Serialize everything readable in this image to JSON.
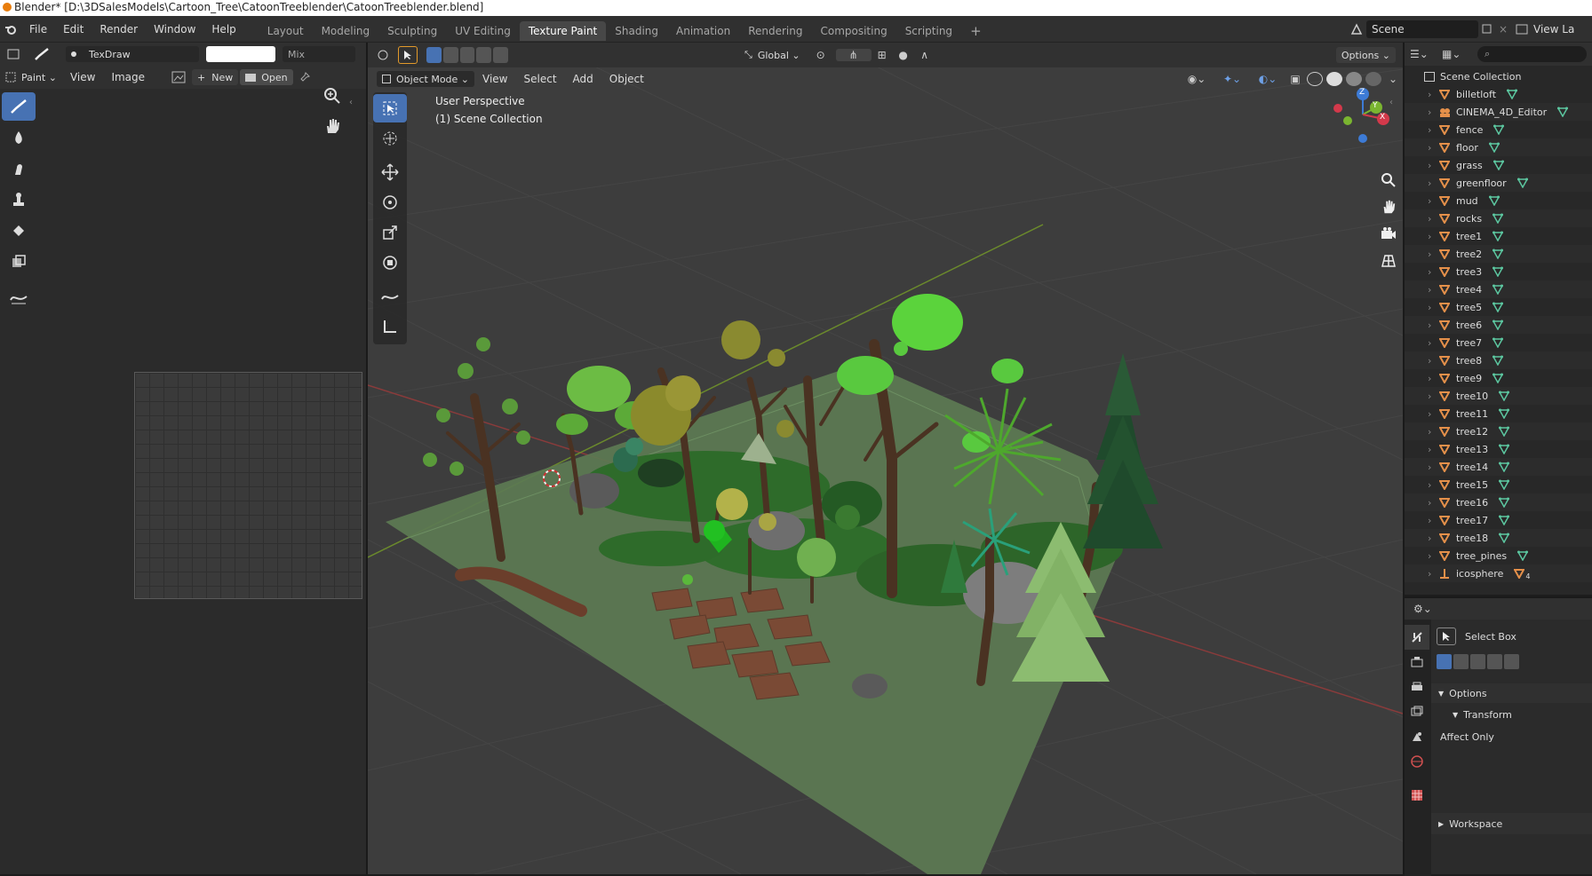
{
  "window": {
    "title": "Blender* [D:\\3DSalesModels\\Cartoon_Tree\\CatoonTreeblender\\CatoonTreeblender.blend]"
  },
  "menubar": {
    "items": [
      "File",
      "Edit",
      "Render",
      "Window",
      "Help"
    ]
  },
  "workspaces": {
    "tabs": [
      "Layout",
      "Modeling",
      "Sculpting",
      "UV Editing",
      "Texture Paint",
      "Shading",
      "Animation",
      "Rendering",
      "Compositing",
      "Scripting"
    ],
    "active": "Texture Paint",
    "add": "+"
  },
  "scene": {
    "name": "Scene",
    "view_layer": "View La"
  },
  "image_editor": {
    "brush_name": "TexDraw",
    "blend_mode": "Mix",
    "mode": "Paint",
    "menu": [
      "View",
      "Image"
    ],
    "new_label": "New",
    "open_label": "Open"
  },
  "viewport": {
    "orientation": "Global",
    "options_label": "Options",
    "mode": "Object Mode",
    "menu": [
      "View",
      "Select",
      "Add",
      "Object"
    ],
    "overlay_line1": "User Perspective",
    "overlay_line2": "(1) Scene Collection",
    "gizmo": {
      "x": "X",
      "y": "Y",
      "z": "Z"
    }
  },
  "outliner": {
    "root": "Scene Collection",
    "items": [
      {
        "name": "billetloft",
        "icon": "orange-triangle"
      },
      {
        "name": "CINEMA_4D_Editor",
        "icon": "orange-people"
      },
      {
        "name": "fence",
        "icon": "orange-triangle"
      },
      {
        "name": "floor",
        "icon": "orange-triangle"
      },
      {
        "name": "grass",
        "icon": "orange-triangle"
      },
      {
        "name": "greenfloor",
        "icon": "orange-triangle"
      },
      {
        "name": "mud",
        "icon": "orange-triangle"
      },
      {
        "name": "rocks",
        "icon": "orange-triangle"
      },
      {
        "name": "tree1",
        "icon": "orange-triangle"
      },
      {
        "name": "tree2",
        "icon": "orange-triangle"
      },
      {
        "name": "tree3",
        "icon": "orange-triangle"
      },
      {
        "name": "tree4",
        "icon": "orange-triangle"
      },
      {
        "name": "tree5",
        "icon": "orange-triangle"
      },
      {
        "name": "tree6",
        "icon": "orange-triangle"
      },
      {
        "name": "tree7",
        "icon": "orange-triangle"
      },
      {
        "name": "tree8",
        "icon": "orange-triangle"
      },
      {
        "name": "tree9",
        "icon": "orange-triangle"
      },
      {
        "name": "tree10",
        "icon": "orange-triangle"
      },
      {
        "name": "tree11",
        "icon": "orange-triangle"
      },
      {
        "name": "tree12",
        "icon": "orange-triangle"
      },
      {
        "name": "tree13",
        "icon": "orange-triangle"
      },
      {
        "name": "tree14",
        "icon": "orange-triangle"
      },
      {
        "name": "tree15",
        "icon": "orange-triangle"
      },
      {
        "name": "tree16",
        "icon": "orange-triangle"
      },
      {
        "name": "tree17",
        "icon": "orange-triangle"
      },
      {
        "name": "tree18",
        "icon": "orange-triangle"
      },
      {
        "name": "tree_pines",
        "icon": "orange-triangle"
      },
      {
        "name": "icosphere",
        "icon": "orange-empty",
        "badge": "4"
      }
    ]
  },
  "properties": {
    "tool_name": "Select Box",
    "options_label": "Options",
    "transform_label": "Transform",
    "affect_only_label": "Affect Only",
    "workspace_label": "Workspace"
  },
  "colors": {
    "accent": "#4772b3",
    "object_orange": "#e5904a",
    "mesh_green": "#5cc7a0"
  }
}
